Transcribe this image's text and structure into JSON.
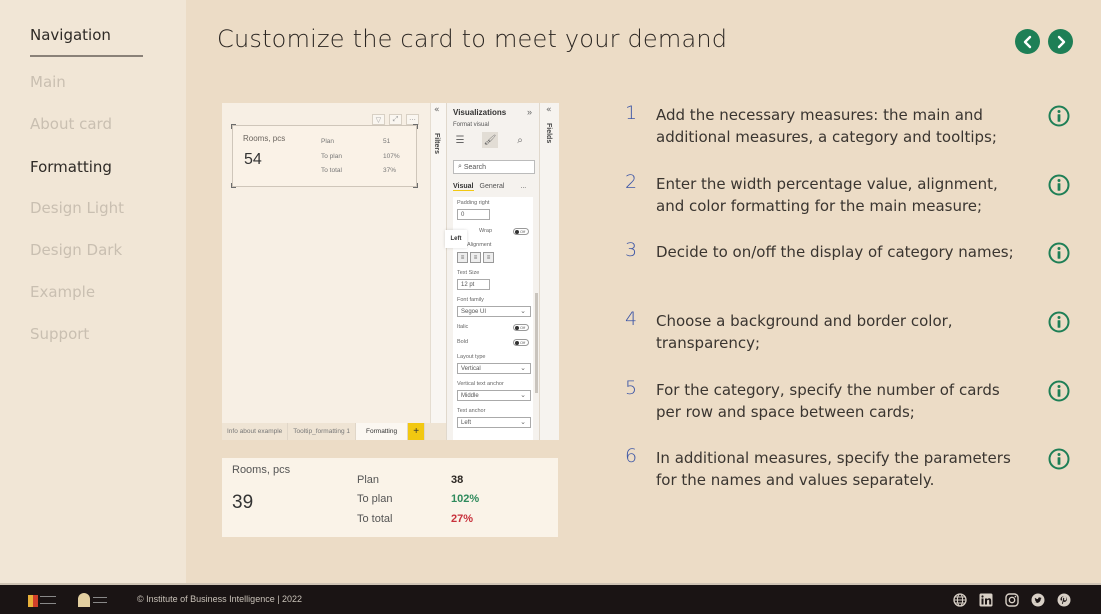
{
  "sidebar": {
    "title": "Navigation",
    "items": [
      {
        "label": "Main",
        "active": false
      },
      {
        "label": "About card",
        "active": false
      },
      {
        "label": "Formatting",
        "active": true
      },
      {
        "label": "Design Light",
        "active": false
      },
      {
        "label": "Design Dark",
        "active": false
      },
      {
        "label": "Example",
        "active": false
      },
      {
        "label": "Support",
        "active": false
      }
    ]
  },
  "header": {
    "title": "Customize the card to meet your demand",
    "prev_icon": "chevron-left-icon",
    "next_icon": "chevron-right-icon",
    "accent_color": "#1e7f56"
  },
  "pbi_screenshot": {
    "card": {
      "category": "Rooms, pcs",
      "main_value": "54",
      "rows": [
        {
          "label": "Plan",
          "value": "51"
        },
        {
          "label": "To plan",
          "value": "107%"
        },
        {
          "label": "To total",
          "value": "37%"
        }
      ]
    },
    "page_tabs": [
      "Info about example",
      "Tooltip_formatting 1",
      "Formatting",
      "+"
    ],
    "filters_label": "Filters",
    "fields_label": "Fields",
    "visualizations": {
      "title": "Visualizations",
      "subtitle": "Format visual",
      "search_placeholder": "Search",
      "tabs": [
        "Visual",
        "General",
        "..."
      ],
      "tooltip": "Left",
      "fields": {
        "padding_right_label": "Padding right",
        "padding_right_value": "0",
        "wrap_label": "Wrap",
        "wrap_toggle": "Off",
        "alignment_label": "Alignment",
        "text_size_label": "Text Size",
        "text_size_value": "12   pt",
        "font_family_label": "Font family",
        "font_family_value": "Segoe UI",
        "italic_label": "Italic",
        "italic_toggle": "Off",
        "bold_label": "Bold",
        "bold_toggle": "Off",
        "layout_type_label": "Layout type",
        "layout_type_value": "Vertical",
        "vertical_anchor_label": "Vertical text anchor",
        "vertical_anchor_value": "Middle",
        "text_anchor_label": "Text anchor",
        "text_anchor_value": "Left"
      }
    }
  },
  "example_card": {
    "category": "Rooms, pcs",
    "main_value": "39",
    "rows": [
      {
        "label": "Plan",
        "value": "38",
        "color": "#2b2622"
      },
      {
        "label": "To plan",
        "value": "102%",
        "color": "#2e8a5c"
      },
      {
        "label": "To total",
        "value": "27%",
        "color": "#c8313c"
      }
    ]
  },
  "steps": [
    {
      "number": "1",
      "text": "Add the necessary measures: the main and additional measures, a category and tooltips;"
    },
    {
      "number": "2",
      "text": "Enter the width percentage value, alignment, and color formatting for the main measure;"
    },
    {
      "number": "3",
      "text": "Decide to on/off the display of category names;"
    },
    {
      "number": "4",
      "text": "Choose a background and border color, transparency;"
    },
    {
      "number": "5",
      "text": "For the category, specify the number of cards per row and space between cards;"
    },
    {
      "number": "6",
      "text": "In additional measures, specify the parameters for the names and values separately."
    }
  ],
  "footer": {
    "copyright": "© Institute of Business Intelligence | 2022",
    "socials": [
      "globe-icon",
      "linkedin-icon",
      "instagram-icon",
      "twitter-icon",
      "pinterest-icon"
    ]
  }
}
